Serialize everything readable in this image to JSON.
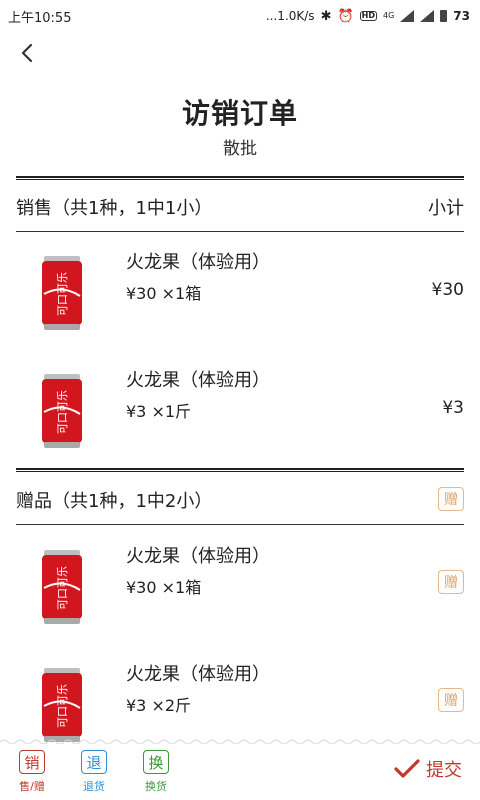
{
  "status_bar": {
    "time": "上午10:55",
    "speed": "...1.0K/s",
    "network": "4G",
    "battery": "73"
  },
  "header": {
    "title": "访销订单",
    "subtitle": "散批"
  },
  "sale_section": {
    "title": "销售（共1种，1中1小）",
    "right_label": "小计",
    "items": [
      {
        "name": "火龙果（体验用）",
        "qty": "¥30 ×1箱",
        "price": "¥30"
      },
      {
        "name": "火龙果（体验用）",
        "qty": "¥3 ×1斤",
        "price": "¥3"
      }
    ]
  },
  "gift_section": {
    "title": "赠品（共1种，1中2小）",
    "badge": "赠",
    "items": [
      {
        "name": "火龙果（体验用）",
        "qty": "¥30 ×1箱",
        "badge": "赠"
      },
      {
        "name": "火龙果（体验用）",
        "qty": "¥3 ×2斤",
        "badge": "赠"
      }
    ]
  },
  "toolbar": {
    "sale": {
      "icon": "销",
      "label": "售/赠",
      "color": "#c0392b"
    },
    "return": {
      "icon": "退",
      "label": "退货",
      "color": "#2a8fd6"
    },
    "exchange": {
      "icon": "换",
      "label": "换货",
      "color": "#3a9a3a"
    },
    "submit_label": "提交"
  }
}
